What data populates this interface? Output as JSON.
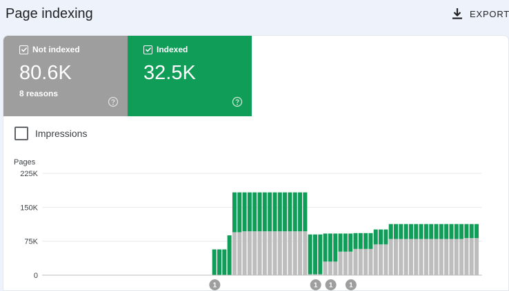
{
  "header": {
    "title": "Page indexing",
    "export_label": "EXPORT"
  },
  "tiles": {
    "not_indexed": {
      "label": "Not indexed",
      "value": "80.6K",
      "sub": "8 reasons",
      "checked": true,
      "color": "#9e9e9e"
    },
    "indexed": {
      "label": "Indexed",
      "value": "32.5K",
      "checked": true,
      "color": "#109d58"
    }
  },
  "impressions": {
    "label": "Impressions",
    "checked": false
  },
  "chart_data": {
    "type": "bar",
    "stacked": true,
    "ylabel": "Pages",
    "y_ticks": [
      "0",
      "75K",
      "150K",
      "225K"
    ],
    "ylim": [
      0,
      225000
    ],
    "grid": true,
    "series": [
      {
        "name": "Not indexed",
        "color": "#bdbdbd",
        "values": [
          0,
          0,
          0,
          0,
          0,
          0,
          0,
          0,
          0,
          0,
          0,
          0,
          0,
          0,
          0,
          0,
          0,
          0,
          0,
          0,
          0,
          0,
          0,
          0,
          0,
          0,
          0,
          0,
          0,
          0,
          0,
          0,
          0,
          0,
          0,
          0,
          0,
          0,
          95000,
          95000,
          97000,
          97000,
          97000,
          97000,
          97000,
          97000,
          97000,
          97000,
          97000,
          97000,
          97000,
          97000,
          97000,
          2000,
          2000,
          2000,
          30000,
          30000,
          30000,
          52000,
          52000,
          52000,
          58000,
          58000,
          58000,
          58000,
          68000,
          68000,
          68000,
          80000,
          80000,
          80000,
          80000,
          80000,
          80000,
          80000,
          80000,
          80000,
          80000,
          80000,
          80000,
          80000,
          80000,
          80000,
          82000,
          82000,
          82000
        ]
      },
      {
        "name": "Indexed",
        "color": "#109d58",
        "values": [
          0,
          0,
          0,
          0,
          0,
          0,
          0,
          0,
          0,
          0,
          0,
          0,
          0,
          0,
          0,
          0,
          0,
          0,
          0,
          0,
          0,
          0,
          0,
          0,
          0,
          0,
          0,
          0,
          0,
          0,
          0,
          0,
          0,
          0,
          0,
          0,
          0,
          0,
          88000,
          88000,
          86000,
          86000,
          86000,
          86000,
          86000,
          86000,
          86000,
          86000,
          86000,
          86000,
          86000,
          86000,
          86000,
          88000,
          88000,
          88000,
          62000,
          62000,
          62000,
          40000,
          40000,
          40000,
          35000,
          35000,
          35000,
          35000,
          33000,
          33000,
          33000,
          33000,
          33000,
          33000,
          33000,
          33000,
          33000,
          33000,
          33000,
          33000,
          33000,
          33000,
          33000,
          33000,
          33000,
          33000,
          31000,
          31000,
          31000
        ]
      }
    ],
    "partial_series": {
      "note": "early bars before main rise",
      "values_not_indexed": [
        0,
        0,
        0,
        0
      ],
      "values_indexed": [
        57000,
        57000,
        57000,
        88000
      ]
    },
    "annotations": [
      {
        "label": "1",
        "bar_index": 33
      },
      {
        "label": "1",
        "bar_index": 53
      },
      {
        "label": "1",
        "bar_index": 56
      },
      {
        "label": "1",
        "bar_index": 60
      }
    ],
    "annotation_color": "#9e9e9e"
  }
}
